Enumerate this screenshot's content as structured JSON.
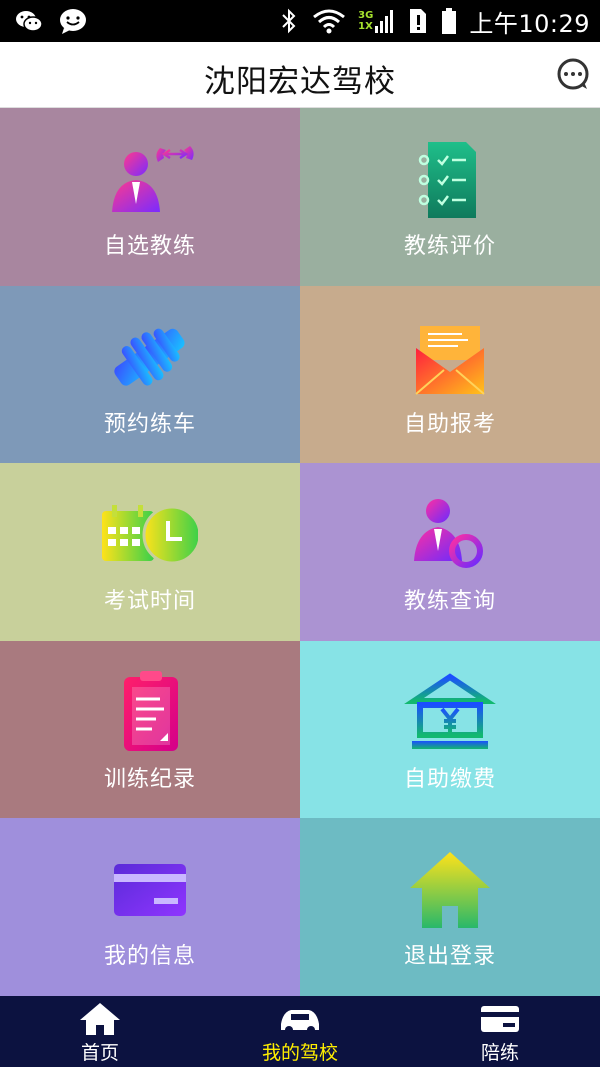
{
  "status_bar": {
    "time": "上午10:29",
    "network_top": "3G",
    "network_bottom": "1X",
    "left_icons": [
      "wechat-icon",
      "chat-bubble-icon"
    ],
    "right_icons": [
      "bluetooth-icon",
      "wifi-icon",
      "signal-icon",
      "sim-alert-icon",
      "battery-icon"
    ]
  },
  "header": {
    "title": "沈阳宏达驾校",
    "message_icon": "message-icon"
  },
  "tiles": [
    {
      "label": "自选教练",
      "icon": "choose-coach-icon",
      "bg": "#a8869f"
    },
    {
      "label": "教练评价",
      "icon": "evaluation-checklist-icon",
      "bg": "#9aaf9f"
    },
    {
      "label": "预约练车",
      "icon": "handshake-icon",
      "bg": "#7e99b8"
    },
    {
      "label": "自助报考",
      "icon": "envelope-icon",
      "bg": "#c7ab8d"
    },
    {
      "label": "考试时间",
      "icon": "calendar-clock-icon",
      "bg": "#c8d09b"
    },
    {
      "label": "教练查询",
      "icon": "coach-search-icon",
      "bg": "#ab93d2"
    },
    {
      "label": "训练纪录",
      "icon": "clipboard-icon",
      "bg": "#a97a7f"
    },
    {
      "label": "自助缴费",
      "icon": "bank-yuan-icon",
      "bg": "#87e3e6"
    },
    {
      "label": "我的信息",
      "icon": "card-icon",
      "bg": "#9f8fdc"
    },
    {
      "label": "退出登录",
      "icon": "home-icon",
      "bg": "#6dbbc3"
    }
  ],
  "tab_bar": {
    "tabs": [
      {
        "label": "首页",
        "icon": "home-icon",
        "active": false
      },
      {
        "label": "我的驾校",
        "icon": "car-icon",
        "active": true
      },
      {
        "label": "陪练",
        "icon": "card-icon",
        "active": false
      }
    ],
    "active_color": "#ffee00"
  }
}
